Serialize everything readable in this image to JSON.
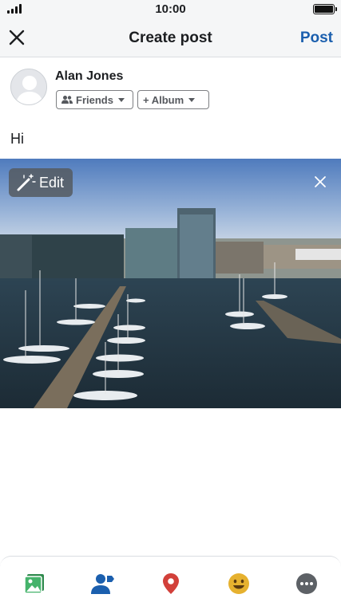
{
  "status_bar": {
    "time": "10:00",
    "signal_icon": "signal-bars-icon",
    "battery_icon": "battery-full-icon"
  },
  "nav": {
    "title": "Create post",
    "post_label": "Post",
    "close_icon": "close-icon"
  },
  "author": {
    "name": "Alan Jones",
    "avatar_icon": "default-avatar-icon"
  },
  "audience": {
    "friends_label": "Friends",
    "album_label": "+ Album"
  },
  "post": {
    "text": "Hi"
  },
  "photo": {
    "edit_label": "Edit",
    "edit_icon": "magic-wand-icon",
    "remove_icon": "close-icon"
  },
  "toolbar": {
    "icons": [
      "photo-icon",
      "tag-people-icon",
      "location-pin-icon",
      "feeling-emoji-icon",
      "more-icon"
    ]
  },
  "colors": {
    "accent": "#1b5fae",
    "photo_green": "#45b36b",
    "tag_blue": "#1b5fae",
    "location_red": "#d2403a",
    "feeling_yellow": "#e6b12f",
    "more_gray": "#5d6166"
  }
}
